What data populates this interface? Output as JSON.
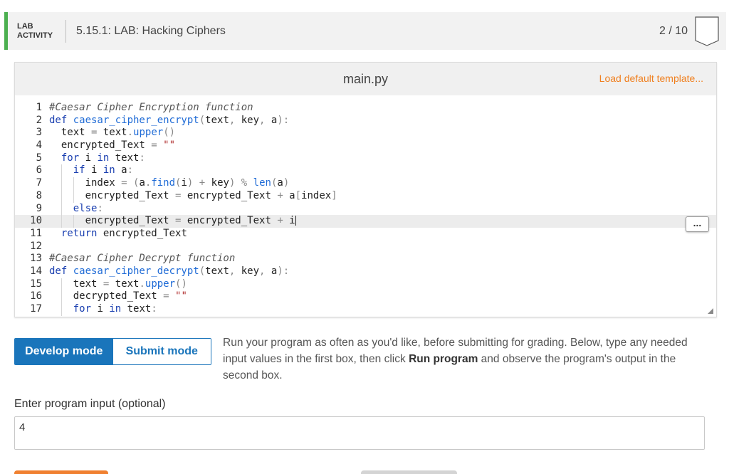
{
  "lab": {
    "tag_line1": "LAB",
    "tag_line2": "ACTIVITY",
    "title": "5.15.1: LAB: Hacking Ciphers",
    "score": "2 / 10"
  },
  "editor": {
    "filename": "main.py",
    "load_template": "Load default template...",
    "more_button": "...",
    "lines": [
      {
        "n": "1",
        "indent": 0,
        "tokens": [
          [
            "c",
            "#Caesar Cipher Encryption function"
          ]
        ]
      },
      {
        "n": "2",
        "indent": 0,
        "tokens": [
          [
            "k",
            "def "
          ],
          [
            "f",
            "caesar_cipher_encrypt"
          ],
          [
            "o",
            "("
          ],
          [
            "p",
            "text"
          ],
          [
            "o",
            ", "
          ],
          [
            "p",
            "key"
          ],
          [
            "o",
            ", "
          ],
          [
            "p",
            "a"
          ],
          [
            "o",
            "):"
          ]
        ]
      },
      {
        "n": "3",
        "indent": 1,
        "tokens": [
          [
            "p",
            "text "
          ],
          [
            "o",
            "= "
          ],
          [
            "p",
            "text"
          ],
          [
            "o",
            "."
          ],
          [
            "f",
            "upper"
          ],
          [
            "o",
            "()"
          ]
        ]
      },
      {
        "n": "4",
        "indent": 1,
        "tokens": [
          [
            "p",
            "encrypted_Text "
          ],
          [
            "o",
            "= "
          ],
          [
            "s",
            "\"\""
          ]
        ]
      },
      {
        "n": "5",
        "indent": 1,
        "tokens": [
          [
            "k",
            "for "
          ],
          [
            "p",
            "i "
          ],
          [
            "k",
            "in "
          ],
          [
            "p",
            "text"
          ],
          [
            "o",
            ":"
          ]
        ]
      },
      {
        "n": "6",
        "indent": 2,
        "tokens": [
          [
            "k",
            "if "
          ],
          [
            "p",
            "i "
          ],
          [
            "k",
            "in "
          ],
          [
            "p",
            "a"
          ],
          [
            "o",
            ":"
          ]
        ]
      },
      {
        "n": "7",
        "indent": 3,
        "tokens": [
          [
            "p",
            "index "
          ],
          [
            "o",
            "= ("
          ],
          [
            "p",
            "a"
          ],
          [
            "o",
            "."
          ],
          [
            "f",
            "find"
          ],
          [
            "o",
            "("
          ],
          [
            "p",
            "i"
          ],
          [
            "o",
            ") + "
          ],
          [
            "p",
            "key"
          ],
          [
            "o",
            ") % "
          ],
          [
            "f",
            "len"
          ],
          [
            "o",
            "("
          ],
          [
            "p",
            "a"
          ],
          [
            "o",
            ")"
          ]
        ]
      },
      {
        "n": "8",
        "indent": 3,
        "tokens": [
          [
            "p",
            "encrypted_Text "
          ],
          [
            "o",
            "= "
          ],
          [
            "p",
            "encrypted_Text "
          ],
          [
            "o",
            "+ "
          ],
          [
            "p",
            "a"
          ],
          [
            "o",
            "["
          ],
          [
            "p",
            "index"
          ],
          [
            "o",
            "]"
          ]
        ]
      },
      {
        "n": "9",
        "indent": 2,
        "tokens": [
          [
            "k",
            "else"
          ],
          [
            "o",
            ":"
          ]
        ]
      },
      {
        "n": "10",
        "indent": 3,
        "active": true,
        "tokens": [
          [
            "p",
            "encrypted_Text "
          ],
          [
            "o",
            "= "
          ],
          [
            "p",
            "encrypted_Text "
          ],
          [
            "o",
            "+ "
          ],
          [
            "p",
            "i"
          ]
        ]
      },
      {
        "n": "11",
        "indent": 1,
        "tokens": [
          [
            "k",
            "return "
          ],
          [
            "p",
            "encrypted_Text"
          ]
        ]
      },
      {
        "n": "12",
        "indent": 0,
        "tokens": []
      },
      {
        "n": "13",
        "indent": 0,
        "tokens": [
          [
            "c",
            "#Caesar Cipher Decrypt function"
          ]
        ]
      },
      {
        "n": "14",
        "indent": 0,
        "tokens": [
          [
            "k",
            "def "
          ],
          [
            "f",
            "caesar_cipher_decrypt"
          ],
          [
            "o",
            "("
          ],
          [
            "p",
            "text"
          ],
          [
            "o",
            ", "
          ],
          [
            "p",
            "key"
          ],
          [
            "o",
            ", "
          ],
          [
            "p",
            "a"
          ],
          [
            "o",
            "):"
          ]
        ]
      },
      {
        "n": "15",
        "indent": 2,
        "tokens": [
          [
            "p",
            "text "
          ],
          [
            "o",
            "= "
          ],
          [
            "p",
            "text"
          ],
          [
            "o",
            "."
          ],
          [
            "f",
            "upper"
          ],
          [
            "o",
            "()"
          ]
        ]
      },
      {
        "n": "16",
        "indent": 2,
        "tokens": [
          [
            "p",
            "decrypted_Text "
          ],
          [
            "o",
            "= "
          ],
          [
            "s",
            "\"\""
          ]
        ]
      },
      {
        "n": "17",
        "indent": 2,
        "tokens": [
          [
            "k",
            "for "
          ],
          [
            "p",
            "i "
          ],
          [
            "k",
            "in "
          ],
          [
            "p",
            "text"
          ],
          [
            "o",
            ":"
          ]
        ]
      }
    ]
  },
  "modes": {
    "develop_label": "Develop mode",
    "submit_label": "Submit mode",
    "active": "develop",
    "description_before": "Run your program as often as you'd like, before submitting for grading. Below, type any needed input values in the first box, then click ",
    "description_bold": "Run program",
    "description_after": " and observe the program's output in the second box."
  },
  "program_input": {
    "label": "Enter program input (optional)",
    "value": "4"
  },
  "colors": {
    "accent_green": "#4caf50",
    "accent_blue": "#1a75bb",
    "accent_orange": "#f08020"
  }
}
